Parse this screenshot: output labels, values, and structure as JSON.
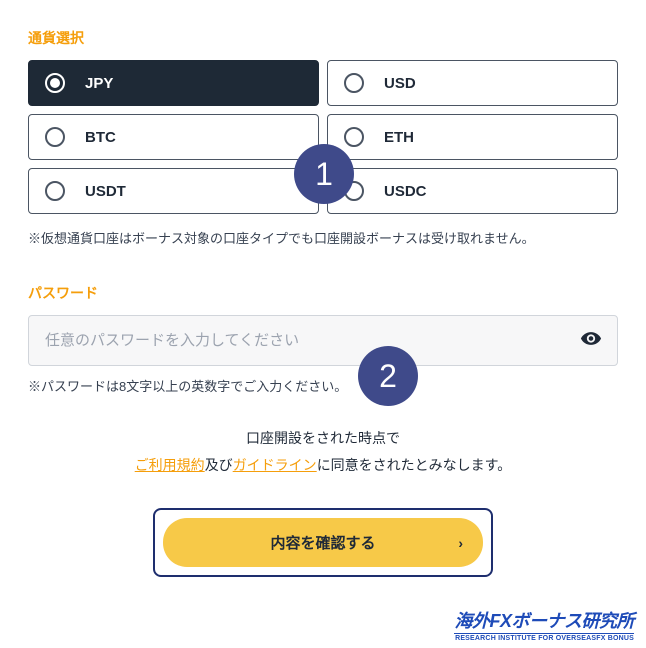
{
  "currency": {
    "label": "通貨選択",
    "options": [
      {
        "value": "JPY",
        "selected": true
      },
      {
        "value": "USD",
        "selected": false
      },
      {
        "value": "BTC",
        "selected": false
      },
      {
        "value": "ETH",
        "selected": false
      },
      {
        "value": "USDT",
        "selected": false
      },
      {
        "value": "USDC",
        "selected": false
      }
    ],
    "note": "※仮想通貨口座はボーナス対象の口座タイプでも口座開設ボーナスは受け取れません。"
  },
  "password": {
    "label": "パスワード",
    "placeholder": "任意のパスワードを入力してください",
    "note": "※パスワードは8文字以上の英数字でご入力ください。"
  },
  "consent": {
    "line1": "口座開設をされた時点で",
    "terms": "ご利用規約",
    "and": "及び",
    "guidelines": "ガイドライン",
    "after": "に同意をされたとみなします。"
  },
  "submit": {
    "label": "内容を確認する"
  },
  "steps": {
    "s1": "1",
    "s2": "2"
  },
  "brand": {
    "jp": "海外FXボーナス研究所",
    "en": "RESEARCH INSTITUTE FOR OVERSEASFX BONUS"
  }
}
